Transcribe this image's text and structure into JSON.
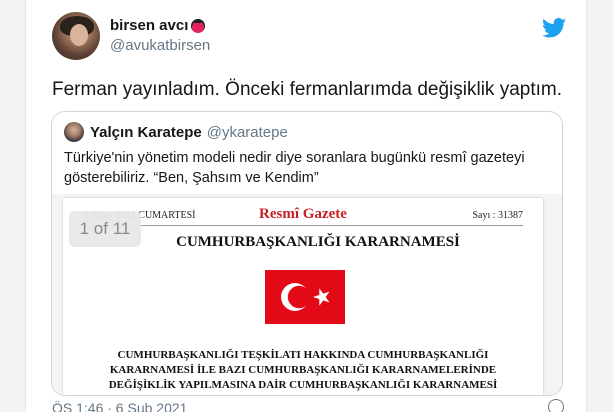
{
  "tweet": {
    "display_name": "birsen avcı",
    "handle": "@avukatbirsen",
    "text": "Ferman yayınladım. Önceki fermanlarımda değişiklik yaptım.",
    "timestamp": "ÖS 1:46 · 6 Şub 2021",
    "name_emoji_icon": "ladybug-icon",
    "brand_icon": "twitter-bird-icon",
    "accent_color": "#1da1f2"
  },
  "quoted_tweet": {
    "display_name": "Yalçın Karatepe",
    "handle": "@ykaratepe",
    "text": "Türkiye'nin yönetim modeli nedir diye soranlara bugünkü resmî gazeteyi gösterebiliriz. “Ben, Şahsım ve Kendim”",
    "media_counter": "1 of 11",
    "document": {
      "date_line": "6 Şubat 2021 CUMARTESİ",
      "masthead": "Resmî Gazete",
      "issue": "Sayı : 31387",
      "decree_title": "CUMHURBAŞKANLIĞI KARARNAMESİ",
      "subtitle_lines": [
        "CUMHURBAŞKANLIĞI TEŞKİLATI HAKKINDA CUMHURBAŞKANLIĞI",
        "KARARNAMESİ İLE BAZI CUMHURBAŞKANLIĞI KARARNAMELERİNDE",
        "DEĞİŞİKLİK YAPILMASINA DAİR CUMHURBAŞKANLIĞI KARARNAMESİ"
      ],
      "flag_color": "#e30a17",
      "masthead_color": "#c62026"
    }
  }
}
